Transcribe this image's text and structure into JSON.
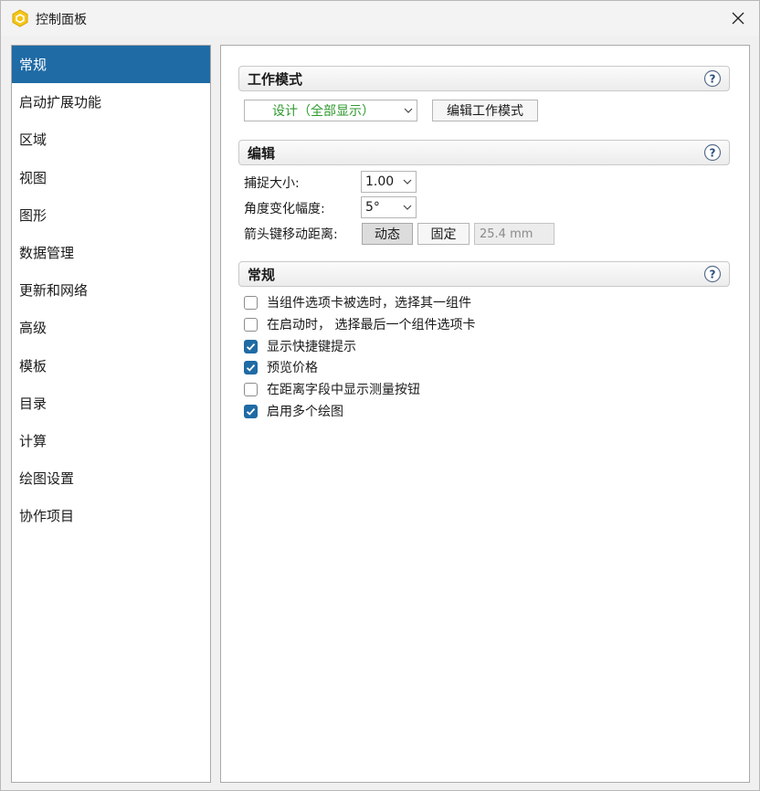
{
  "window": {
    "title": "控制面板"
  },
  "sidebar": {
    "items": [
      {
        "label": "常规",
        "selected": true
      },
      {
        "label": "启动扩展功能"
      },
      {
        "label": "区域"
      },
      {
        "label": "视图"
      },
      {
        "label": "图形"
      },
      {
        "label": "数据管理"
      },
      {
        "label": "更新和网络"
      },
      {
        "label": "高级"
      },
      {
        "label": "模板"
      },
      {
        "label": "目录"
      },
      {
        "label": "计算"
      },
      {
        "label": "绘图设置"
      },
      {
        "label": "协作项目"
      }
    ]
  },
  "work_mode": {
    "header": "工作模式",
    "mode_value": "设计（全部显示）",
    "mode_color": "#2e9a2e",
    "edit_button": "编辑工作模式"
  },
  "edit": {
    "header": "编辑",
    "snap_label": "捕捉大小:",
    "snap_value": "1.00",
    "angle_label": "角度变化幅度:",
    "angle_value": "5°",
    "arrow_label": "箭头键移动距离:",
    "dynamic_button": "动态",
    "fixed_button": "固定",
    "distance_value": "25.4 mm"
  },
  "general": {
    "header": "常规",
    "options": [
      {
        "label": "当组件选项卡被选时，选择其一组件",
        "checked": false
      },
      {
        "label": "在启动时， 选择最后一个组件选项卡",
        "checked": false
      },
      {
        "label": "显示快捷键提示",
        "checked": true
      },
      {
        "label": "预览价格",
        "checked": true
      },
      {
        "label": "在距离字段中显示测量按钮",
        "checked": false
      },
      {
        "label": "启用多个绘图",
        "checked": true
      }
    ]
  },
  "colors": {
    "accent": "#1f6ba5",
    "icon_yellow": "#f5c518"
  }
}
